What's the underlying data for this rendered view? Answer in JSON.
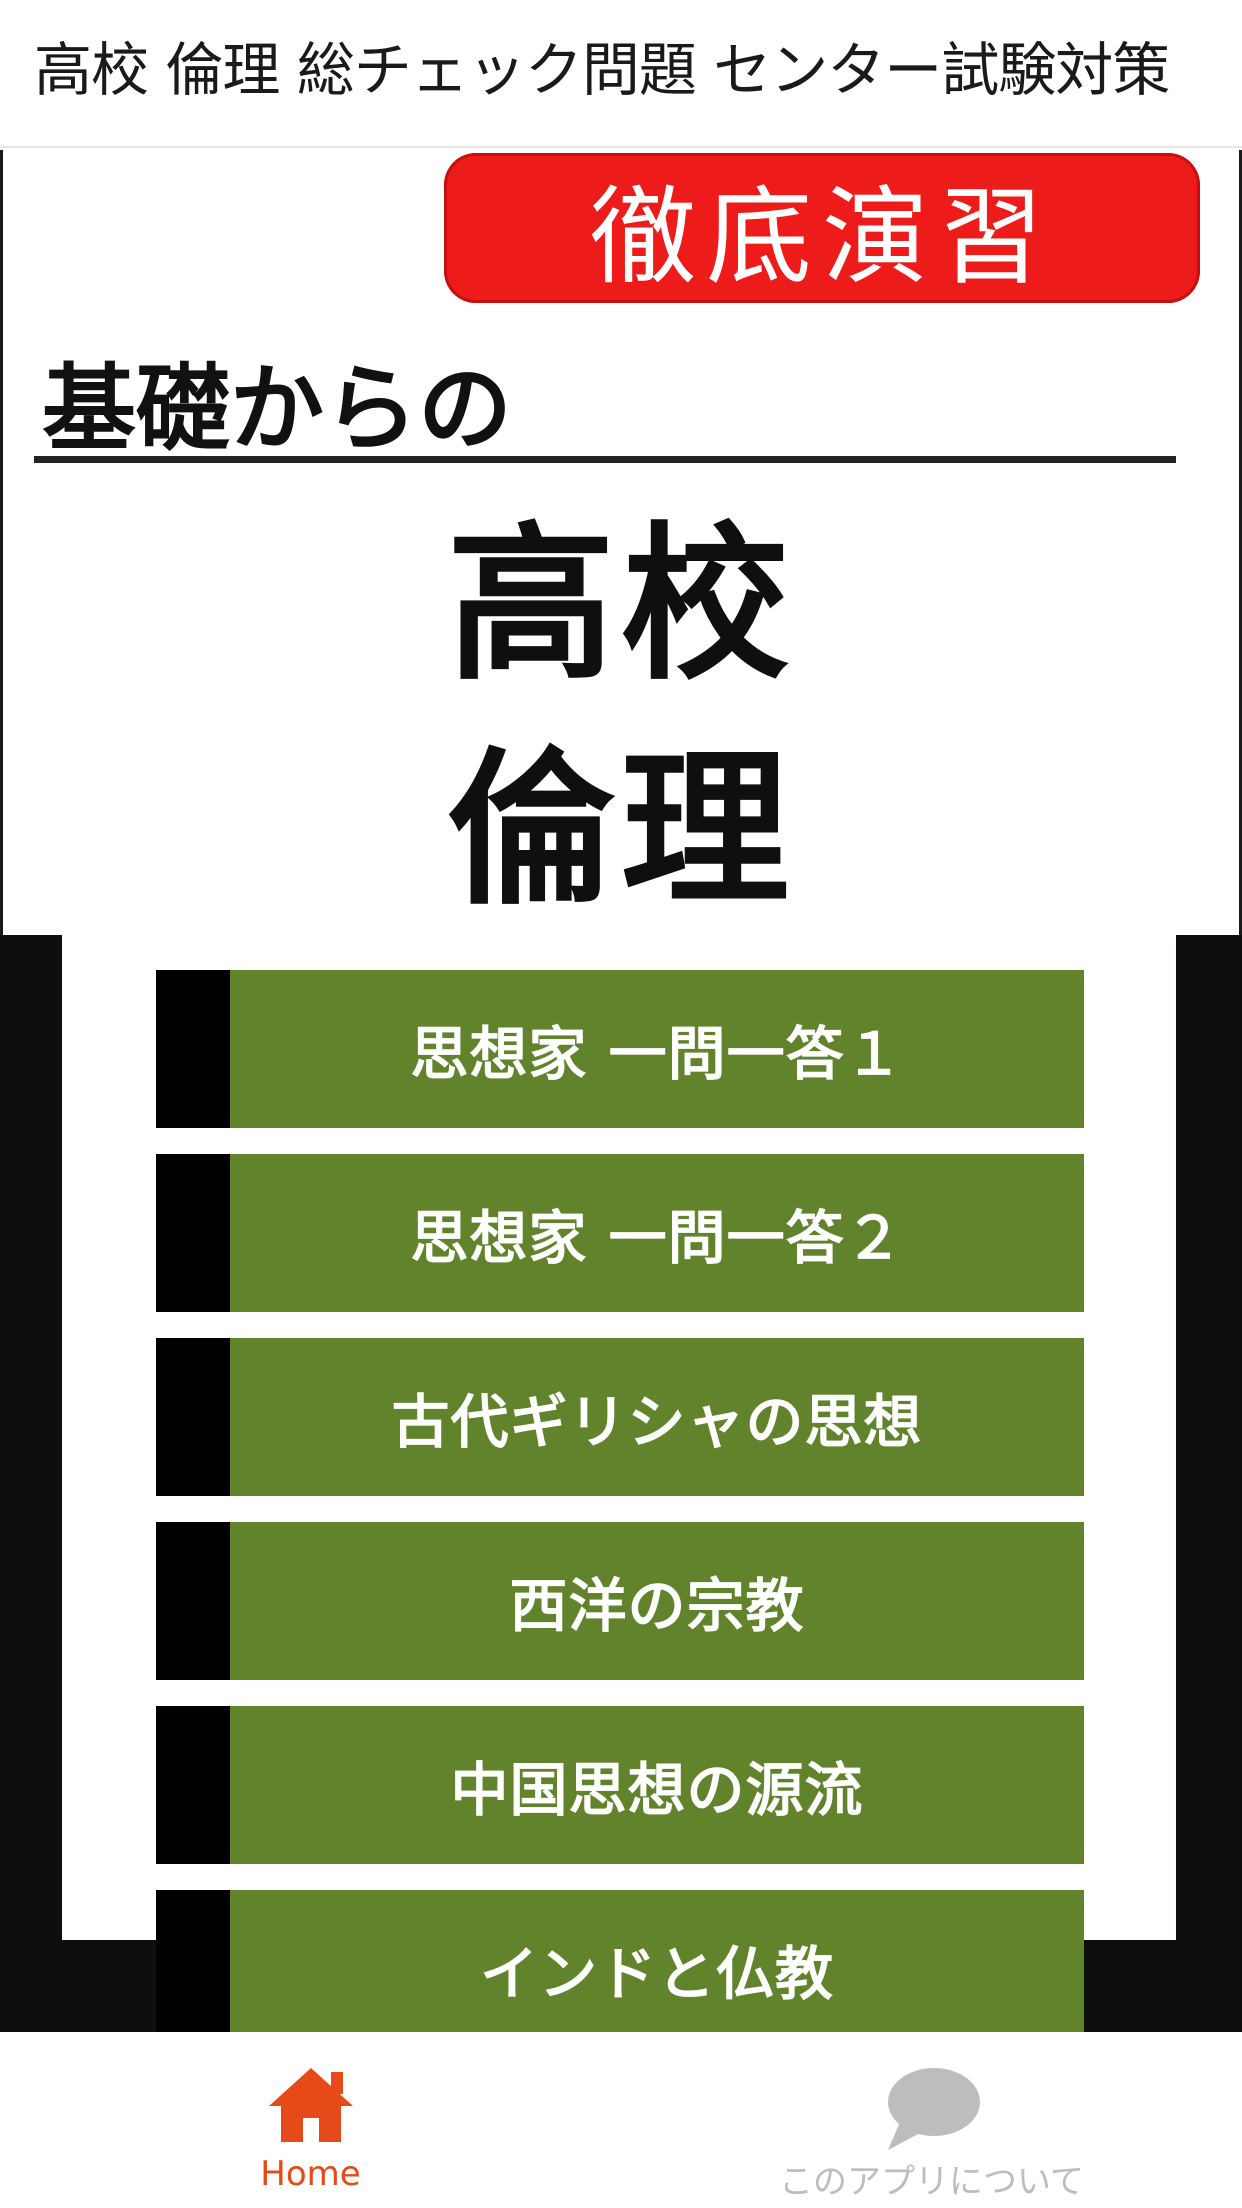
{
  "app_bar": {
    "title": "高校 倫理 総チェック問題 センター試験対策"
  },
  "hero": {
    "banner_text": "徹底演習",
    "subtitle": "基礎からの",
    "title_line1": "高校",
    "title_line2": "倫理",
    "banner_color": "#ee1b1b"
  },
  "menu": {
    "item_color": "#61832c",
    "items": [
      {
        "label": "思想家 一問一答１"
      },
      {
        "label": "思想家 一問一答２"
      },
      {
        "label": "古代ギリシャの思想"
      },
      {
        "label": "西洋の宗教"
      },
      {
        "label": "中国思想の源流"
      },
      {
        "label": "インドと仏教"
      }
    ]
  },
  "bottom_nav": {
    "items": [
      {
        "label": "Home",
        "icon": "home-icon",
        "active": true,
        "color": "#e64a19"
      },
      {
        "label": "このアプリについて",
        "icon": "chat-bubble-icon",
        "active": false,
        "color": "#bdbdbd"
      }
    ]
  }
}
